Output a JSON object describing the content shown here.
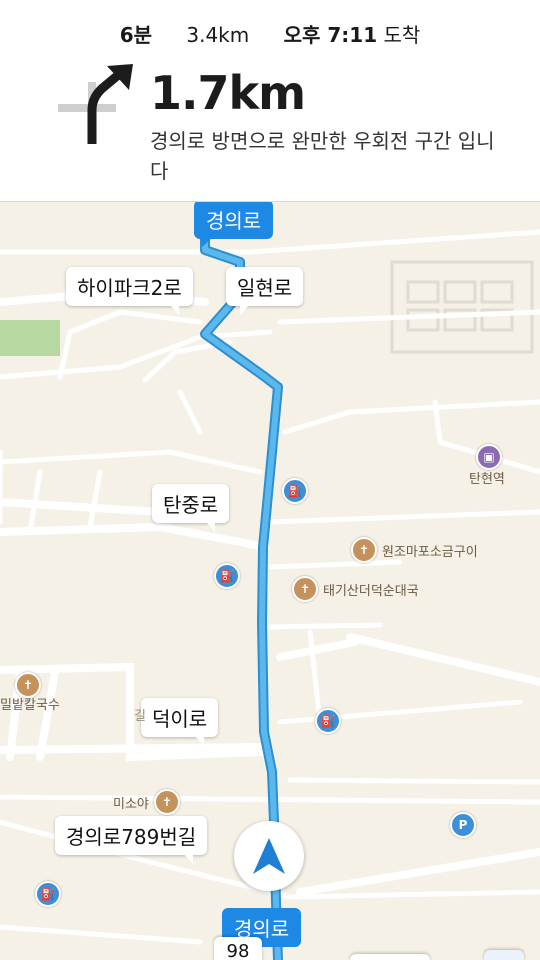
{
  "header": {
    "eta_minutes": "6분",
    "eta_distance": "3.4km",
    "arrival_time": "오후 7:11",
    "arrival_suffix": "도착",
    "next_distance": "1.7km",
    "instruction": "경의로 방면으로 완만한 우회전 구간 입니다",
    "maneuver_icon": "slight-right-turn-icon"
  },
  "map": {
    "route_color": "#3ea2de",
    "road_badges": {
      "top": "경의로",
      "bottom": "경의로"
    },
    "callouts": {
      "hipark": "하이파크2로",
      "ilhyeon": "일현로",
      "tanjung": "탄중로",
      "deogi": "덕이로",
      "gyeongui789": "경의로789번길"
    },
    "pois": {
      "tanhyeon_station": "탄현역",
      "wonjo": "원조마포소금구이",
      "taegisan": "태기산더덕순대국",
      "kalguksu": "밀밭칼국수",
      "misoya": "미소야"
    },
    "route_shield": "98",
    "faint_label": "길"
  }
}
